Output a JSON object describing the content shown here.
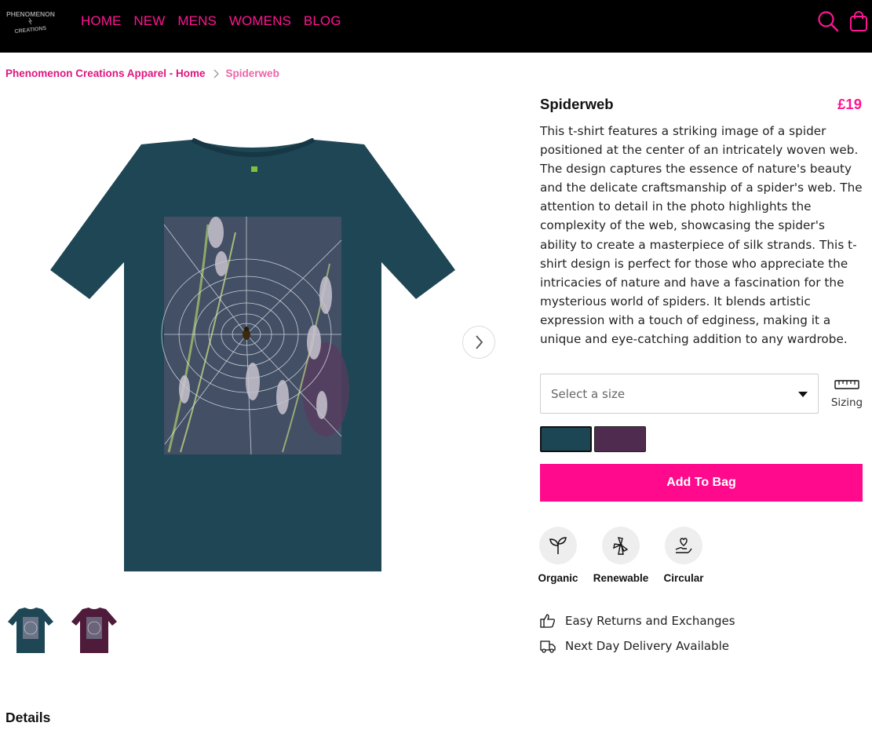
{
  "brand": {
    "logo_line1": "PHENOMENON",
    "logo_line2": "CREATIONS"
  },
  "nav": [
    "HOME",
    "NEW",
    "MENS",
    "WOMENS",
    "BLOG"
  ],
  "header_icons": [
    "search-icon",
    "shopping-bag-icon"
  ],
  "breadcrumb": {
    "home": "Phenomenon Creations Apparel - Home",
    "current": "Spiderweb"
  },
  "product": {
    "title": "Spiderweb",
    "price": "£19",
    "description": "This t-shirt features a striking image of a spider positioned at the center of an intricately woven web. The design captures the essence of nature's beauty and the delicate craftsmanship of a spider's web. The attention to detail in the photo highlights the complexity of the web, showcasing the spider's ability to create a masterpiece of silk strands. This t-shirt design is perfect for those who appreciate the intricacies of nature and have a fascination for the mysterious world of spiders. It blends artistic expression with a touch of edginess, making it a unique and eye-catching addition to any wardrobe.",
    "size_placeholder": "Select a size",
    "sizing_label": "Sizing",
    "colors": [
      {
        "name": "denim-blue",
        "hex": "#1d4654",
        "selected": true
      },
      {
        "name": "plum",
        "hex": "#4f2b4f",
        "selected": false
      }
    ],
    "add_to_bag": "Add To Bag"
  },
  "features": [
    {
      "label": "Organic",
      "icon": "sprout-icon"
    },
    {
      "label": "Renewable",
      "icon": "wind-turbine-icon"
    },
    {
      "label": "Circular",
      "icon": "heart-hand-icon"
    }
  ],
  "perks": [
    {
      "label": "Easy Returns and Exchanges",
      "icon": "thumbs-up-icon"
    },
    {
      "label": "Next Day Delivery Available",
      "icon": "delivery-truck-icon"
    }
  ],
  "details_heading": "Details",
  "colors": {
    "accent": "#ff1493",
    "button": "#ff0a8c",
    "header_bg": "#000000"
  }
}
